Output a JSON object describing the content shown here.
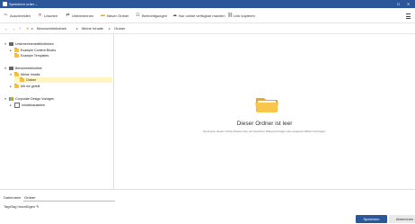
{
  "window": {
    "title": "Speichern unter –",
    "maximize_glyph": "☐",
    "close_glyph": "✕"
  },
  "toolbar": {
    "items": [
      {
        "label": "Auschneiden",
        "icon": "cut-icon",
        "glyph": "✂",
        "color": "#666666"
      },
      {
        "label": "Löschen",
        "icon": "delete-icon",
        "glyph": "✕",
        "color": "#d13438"
      },
      {
        "label": "Umbenennen",
        "icon": "rename-icon",
        "glyph": "⇄",
        "color": "#555555"
      },
      {
        "label": "Neuer Ordner",
        "icon": "new-folder-icon",
        "glyph": "▬",
        "color": "#e6a82a"
      },
      {
        "label": "Berechtigungen",
        "icon": "permissions-icon",
        "glyph": "☷",
        "color": "#555555"
      },
      {
        "label": "Nur online verfügbar machen",
        "icon": "cloud-icon",
        "glyph": "☁",
        "color": "#555555"
      },
      {
        "label": "Link kopieren",
        "icon": "link-icon",
        "glyph": "⛓",
        "color": "#555555"
      }
    ],
    "menu_icon": "hamburger-menu-icon"
  },
  "nav": {
    "back": "←",
    "forward": "→",
    "up": "↑",
    "home_glyph": "★",
    "breadcrumb": [
      "Benutzerbibliothek",
      "Meine Inhalte",
      "Ordner"
    ],
    "separator": "▸"
  },
  "tree": [
    {
      "label": "Unternehmensbibliotheken",
      "expander": "▾",
      "icon": "library-icon"
    },
    {
      "label": "Example Content Blocks",
      "expander": "▸",
      "icon": "folder-icon"
    },
    {
      "label": "Example Templates",
      "expander": "",
      "icon": "folder-icon"
    },
    {
      "label": "Benutzerbibliothek",
      "expander": "▾",
      "icon": "library-icon"
    },
    {
      "label": "Meine Inhalte",
      "expander": "▾",
      "icon": "folder-icon"
    },
    {
      "label": "Ordner",
      "expander": "",
      "icon": "folder-icon",
      "selected": true
    },
    {
      "label": "Mit mir geteilt",
      "expander": "▸",
      "icon": "folder-icon"
    },
    {
      "label": "Corporate Design Vorlagen",
      "expander": "▾",
      "icon": "library-icon"
    },
    {
      "label": "Inhaltsbausteine",
      "expander": "▸",
      "icon": "library-icon"
    }
  ],
  "main": {
    "empty_title": "Dieser Ordner ist leer",
    "empty_description": "Sie können diesem Ordner Dateien über den Speichern Dialog hinzufügen oder eingesetzt Ribbon hinzufügen."
  },
  "bottom": {
    "filename_label": "Dateiname",
    "filename_value": "Ordner",
    "tags_label": "Tags",
    "tags_add": "Tag hinzufügen",
    "tags_add_glyph": "✎",
    "save_label": "Speichern",
    "cancel_label": "Abbrechen"
  },
  "colors": {
    "accent": "#2b579a",
    "folder": "#f4c044",
    "selection": "#fff4c2"
  }
}
